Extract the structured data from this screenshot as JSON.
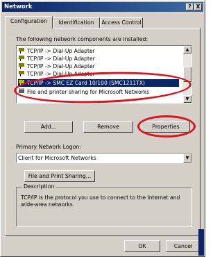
{
  "window": {
    "title": "Network",
    "help_label": "?",
    "close_label": "X"
  },
  "tabs": [
    {
      "label": "Configuration",
      "active": true
    },
    {
      "label": "Identification",
      "active": false
    },
    {
      "label": "Access Control",
      "active": false
    }
  ],
  "components": {
    "heading": "The following network components are installed:",
    "items": [
      {
        "label": "TCP/IP -> Dial-Up Adapter"
      },
      {
        "label": "TCP/IP -> Dial-Up Adapter"
      },
      {
        "label": "TCP/IP -> Dial-Up Adapter"
      },
      {
        "label": "TCP/IP -> Dial-Up Adapter"
      },
      {
        "label": "TCP/IP -> SMC EZ Card 10/100 (SMC1211TX)",
        "selected": true
      },
      {
        "label": "File and printer sharing for Microsoft Networks"
      }
    ]
  },
  "buttons": {
    "add": "Add...",
    "remove": "Remove",
    "properties": "Properties",
    "file_print_sharing": "File and Print Sharing...",
    "ok": "OK",
    "cancel": "Cancel"
  },
  "logon": {
    "label": "Primary Network Logon:",
    "value": "Client for Microsoft Networks"
  },
  "description": {
    "title": "Description",
    "text": "TCP/IP is the protocol you use to connect to the Internet and wide-area networks."
  },
  "colors": {
    "highlight_oval": "#e0101a",
    "selection": "#0a246a",
    "face": "#d4d0c8"
  },
  "icons": {
    "scroll_up": "▲",
    "scroll_down": "▼",
    "dropdown": "▼"
  }
}
